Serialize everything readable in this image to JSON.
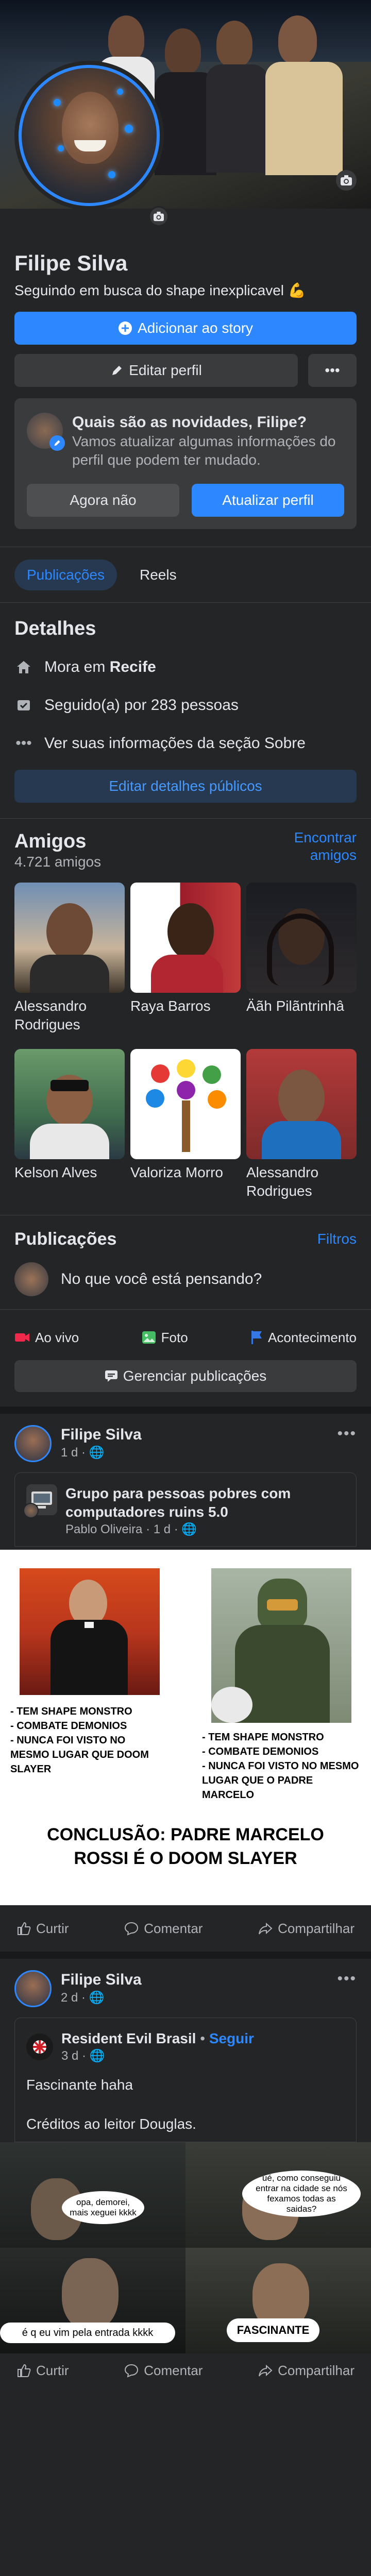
{
  "profile": {
    "name": "Filipe Silva",
    "bio": "Seguindo em busca do shape inexplicavel 💪",
    "add_story_label": "Adicionar ao story",
    "edit_profile_label": "Editar perfil",
    "more_label": "•••"
  },
  "news_card": {
    "title": "Quais são as novidades, Filipe?",
    "text": "Vamos atualizar algumas informações do perfil que podem ter mudado.",
    "dismiss_label": "Agora não",
    "update_label": "Atualizar perfil"
  },
  "tabs": [
    {
      "label": "Publicações",
      "active": true
    },
    {
      "label": "Reels",
      "active": false
    }
  ],
  "details": {
    "title": "Detalhes",
    "lives_prefix": "Mora em ",
    "lives_city": "Recife",
    "followers": "Seguido(a) por 283 pessoas",
    "about": "Ver suas informações da seção Sobre",
    "edit_public_label": "Editar detalhes públicos"
  },
  "friends": {
    "title": "Amigos",
    "count": "4.721 amigos",
    "find_label": "Encontrar amigos",
    "items": [
      {
        "name": "Alessandro Rodrigues"
      },
      {
        "name": "Raya Barros"
      },
      {
        "name": "Äãh Pilãntrinhâ"
      },
      {
        "name": "Kelson Alves"
      },
      {
        "name": "Valoriza Morro"
      },
      {
        "name": "Alessandro Rodrigues"
      }
    ]
  },
  "publications": {
    "title": "Publicações",
    "filters_label": "Filtros",
    "composer_placeholder": "No que você está pensando?",
    "quick": [
      {
        "label": "Ao vivo",
        "icon": "live-video-icon",
        "color": "#f02849"
      },
      {
        "label": "Foto",
        "icon": "photo-icon",
        "color": "#45bd62"
      },
      {
        "label": "Acontecimento",
        "icon": "flag-icon",
        "color": "#3578e5"
      }
    ],
    "manage_label": "Gerenciar publicações"
  },
  "post1": {
    "author": "Filipe Silva",
    "meta": "1 d · 🌐",
    "group_name": "Grupo para pessoas pobres com computadores ruins 5.0",
    "group_meta": "Pablo Oliveira · 1 d · 🌐",
    "meme": {
      "left_caption": "- TEM SHAPE MONSTRO\n- COMBATE DEMONIOS\n- NUNCA FOI VISTO NO MESMO LUGAR QUE DOOM SLAYER",
      "right_caption": "- TEM SHAPE MONSTRO\n- COMBATE DEMONIOS\n- NUNCA FOI VISTO NO MESMO LUGAR QUE O PADRE MARCELO",
      "conclusion": "CONCLUSÃO: PADRE MARCELO ROSSI É O DOOM SLAYER"
    }
  },
  "post2": {
    "author": "Filipe Silva",
    "meta": "2 d · 🌐",
    "page_name": "Resident Evil Brasil",
    "follow_label": "Seguir",
    "page_meta": "3 d · 🌐",
    "text1": "Fascinante haha",
    "text2": "Créditos ao leitor Douglas.",
    "meme": {
      "bubble1": "opa, demorei, mais xeguei kkkk",
      "bubble2": "ué, como conseguiu entrar na cidade se nós fexamos todas as saidas?",
      "bubble3": "é q eu vim pela entrada kkkk",
      "bubble4": "FASCINANTE"
    }
  },
  "actions": {
    "like": "Curtir",
    "comment": "Comentar",
    "share": "Compartilhar"
  }
}
